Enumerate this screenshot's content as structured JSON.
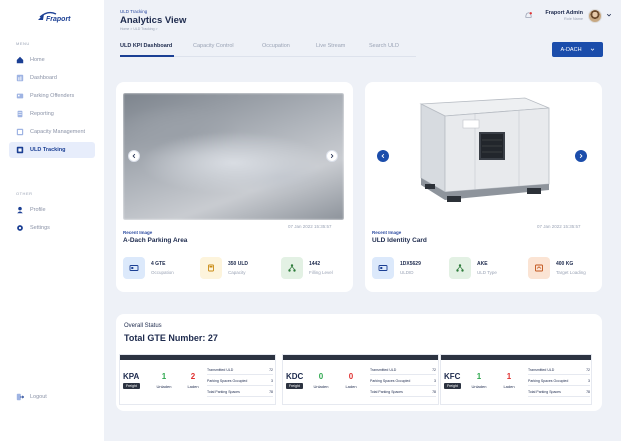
{
  "brand": {
    "logo_text": "Fraport"
  },
  "sidebar": {
    "menu_label": "MENU",
    "items": [
      {
        "label": "Home",
        "icon": "home-icon"
      },
      {
        "label": "Dashboard",
        "icon": "dashboard-icon"
      },
      {
        "label": "Parking Offenders",
        "icon": "parking-icon"
      },
      {
        "label": "Reporting",
        "icon": "reporting-icon"
      },
      {
        "label": "Capacity Management",
        "icon": "capacity-icon"
      },
      {
        "label": "ULD Tracking",
        "icon": "tracking-icon",
        "active": true
      }
    ],
    "other_label": "OTHER",
    "other_items": [
      {
        "label": "Profile",
        "icon": "profile-icon"
      },
      {
        "label": "Settings",
        "icon": "settings-icon"
      }
    ],
    "logout": "Logout"
  },
  "header": {
    "subtitle": "ULD Tracking",
    "title": "Analytics View",
    "breadcrumb": "Home > ULD Tracking >",
    "user_name": "Fraport Admin",
    "user_role": "Role Name"
  },
  "tabs": [
    "ULD KPI Dashboard",
    "Capacity Control",
    "Occupation",
    "Live Stream",
    "Search ULD"
  ],
  "location_button": "A-DACH",
  "card_left": {
    "timestamp": "07 Jan 2022 15:35:57",
    "subtitle": "Recent Image",
    "title": "A-Dach Parking Area",
    "stats": [
      {
        "value": "4 GTE",
        "label": "Occupation",
        "icon": "id-card-icon",
        "color": "#dce9fb"
      },
      {
        "value": "350 ULD",
        "label": "Capacity",
        "icon": "fuel-icon",
        "color": "#fdf4dc"
      },
      {
        "value": "1442",
        "label": "Filling Level",
        "icon": "network-icon",
        "color": "#e3f1e4"
      }
    ]
  },
  "card_right": {
    "timestamp": "07 Jan 2022 15:35:57",
    "subtitle": "Recent Image",
    "title": "ULD Identity Card",
    "stats": [
      {
        "value": "1DX5629",
        "label": "ULDID",
        "icon": "id-card-icon",
        "color": "#dce9fb"
      },
      {
        "value": "AKE",
        "label": "ULD Type",
        "icon": "network-icon",
        "color": "#e3f1e4"
      },
      {
        "value": "400 KG",
        "label": "Target Loading",
        "icon": "scale-icon",
        "color": "#fbe4d4"
      }
    ]
  },
  "overall": {
    "label": "Overall Status",
    "total": "Total GTE Number: 27"
  },
  "terminals": [
    {
      "code": "KPA",
      "badge": "Freight",
      "loaded": "1",
      "unloaded": "2",
      "loaded_label": "Unladen",
      "unloaded_label": "Laden",
      "rows": [
        {
          "k": "Transmitted ULD",
          "v": "72"
        },
        {
          "k": "Parking Spaces Occupied",
          "v": "3"
        },
        {
          "k": "Total Parking Spaces",
          "v": "78"
        }
      ]
    },
    {
      "code": "KDC",
      "badge": "Freight",
      "loaded": "0",
      "unloaded": "0",
      "loaded_label": "Unladen",
      "unloaded_label": "Laden",
      "rows": [
        {
          "k": "Transmitted ULD",
          "v": "72"
        },
        {
          "k": "Parking Spaces Occupied",
          "v": "3"
        },
        {
          "k": "Total Parking Spaces",
          "v": "78"
        }
      ]
    },
    {
      "code": "KFC",
      "badge": "Freight",
      "loaded": "1",
      "unloaded": "1",
      "loaded_label": "Unladen",
      "unloaded_label": "Laden",
      "rows": [
        {
          "k": "Transmitted ULD",
          "v": "72"
        },
        {
          "k": "Parking Spaces Occupied",
          "v": "3"
        },
        {
          "k": "Total Parking Spaces",
          "v": "78"
        }
      ]
    }
  ],
  "colors": {
    "primary": "#1b4dab",
    "green": "#2fa84f",
    "red": "#e03131"
  }
}
